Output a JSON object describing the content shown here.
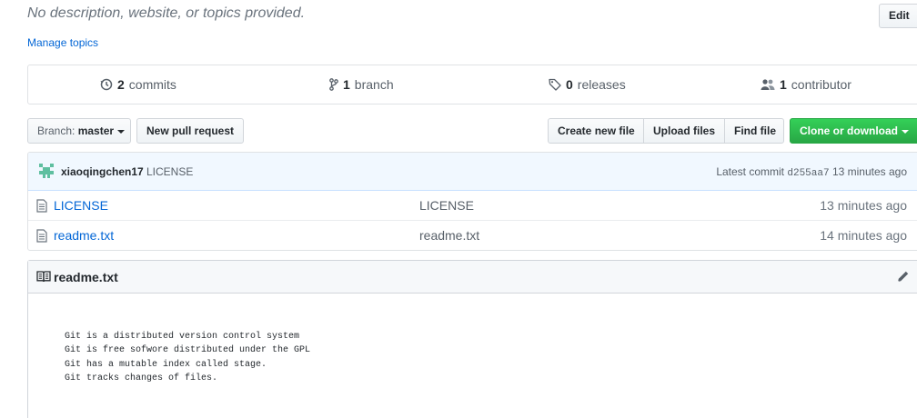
{
  "repo": {
    "description": "No description, website, or topics provided.",
    "edit_label": "Edit",
    "manage_topics": "Manage topics"
  },
  "stats": {
    "commits_count": "2",
    "commits_label": "commits",
    "branch_count": "1",
    "branch_label": "branch",
    "releases_count": "0",
    "releases_label": "releases",
    "contributors_count": "1",
    "contributors_label": "contributor"
  },
  "toolbar": {
    "branch_prefix": "Branch:",
    "branch_name": "master",
    "new_pr": "New pull request",
    "create_file": "Create new file",
    "upload_files": "Upload files",
    "find_file": "Find file",
    "clone": "Clone or download"
  },
  "commit": {
    "author": "xiaoqingchen17",
    "message": "LICENSE",
    "latest_label": "Latest commit",
    "sha": "d255aa7",
    "age": "13 minutes ago"
  },
  "files": [
    {
      "name": "LICENSE",
      "message": "LICENSE",
      "age": "13 minutes ago",
      "icon": "file-icon"
    },
    {
      "name": "readme.txt",
      "message": "readme.txt",
      "age": "14 minutes ago",
      "icon": "file-icon"
    }
  ],
  "readme": {
    "title": "readme.txt",
    "lines": [
      "Git is a distributed version control system",
      "Git is free sofwore distributed under the GPL",
      "Git has a mutable index called stage.",
      "Git tracks changes of files."
    ]
  },
  "colors": {
    "link": "#0366d6",
    "clone_button": "#28a745",
    "commit_bar": "#f1f8ff"
  }
}
